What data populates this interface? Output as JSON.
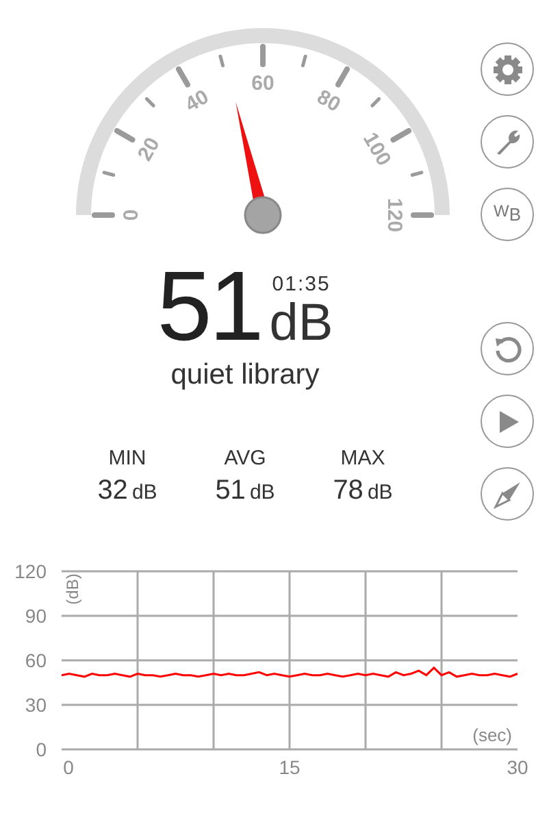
{
  "gauge": {
    "labels": [
      "0",
      "20",
      "40",
      "60",
      "80",
      "100",
      "120"
    ]
  },
  "reading": {
    "value": "51",
    "unit": "dB",
    "timer": "01:35",
    "description": "quiet library"
  },
  "stats": [
    {
      "label": "MIN",
      "value": "32",
      "unit": "dB"
    },
    {
      "label": "AVG",
      "value": "51",
      "unit": "dB"
    },
    {
      "label": "MAX",
      "value": "78",
      "unit": "dB"
    }
  ],
  "buttons": [
    {
      "kind": "gear"
    },
    {
      "kind": "wrench"
    },
    {
      "kind": "text",
      "label": "$^{W}$$_{B}$"
    },
    {
      "kind": "reset"
    },
    {
      "kind": "play"
    },
    {
      "kind": "compass"
    }
  ],
  "chart_data": {
    "type": "line",
    "xlabel": "(sec)",
    "ylabel": "(dB)",
    "grid": true,
    "xlim": [
      0,
      30
    ],
    "ylim": [
      0,
      120
    ],
    "xticks": [
      {
        "value": 0,
        "label": "0"
      },
      {
        "value": 15,
        "label": "15"
      },
      {
        "value": 30,
        "label": "30"
      }
    ],
    "yticks": [
      0,
      30,
      60,
      90,
      120
    ],
    "x": [
      0,
      0.5,
      1,
      1.5,
      2,
      2.5,
      3,
      3.5,
      4,
      4.5,
      5,
      5.5,
      6,
      6.5,
      7,
      7.5,
      8,
      8.5,
      9,
      9.5,
      10,
      10.5,
      11,
      11.5,
      12,
      12.5,
      13,
      13.5,
      14,
      14.5,
      15,
      15.5,
      16,
      16.5,
      17,
      17.5,
      18,
      18.5,
      19,
      19.5,
      20,
      20.5,
      21,
      21.5,
      22,
      22.5,
      23,
      23.5,
      24,
      24.5,
      25,
      25.5,
      26,
      26.5,
      27,
      27.5,
      28,
      28.5,
      29,
      29.5,
      30
    ],
    "series": [
      {
        "color": "#ff0000",
        "values": [
          50,
          51,
          50,
          49,
          51,
          50,
          50,
          51,
          50,
          49,
          51,
          50,
          50,
          49,
          50,
          51,
          50,
          50,
          49,
          50,
          51,
          50,
          51,
          50,
          50,
          51,
          52,
          50,
          51,
          50,
          49,
          50,
          51,
          50,
          50,
          51,
          50,
          49,
          50,
          51,
          50,
          51,
          50,
          49,
          52,
          50,
          51,
          53,
          50,
          55,
          50,
          52,
          49,
          50,
          51,
          50,
          50,
          51,
          50,
          49,
          51
        ]
      }
    ]
  }
}
